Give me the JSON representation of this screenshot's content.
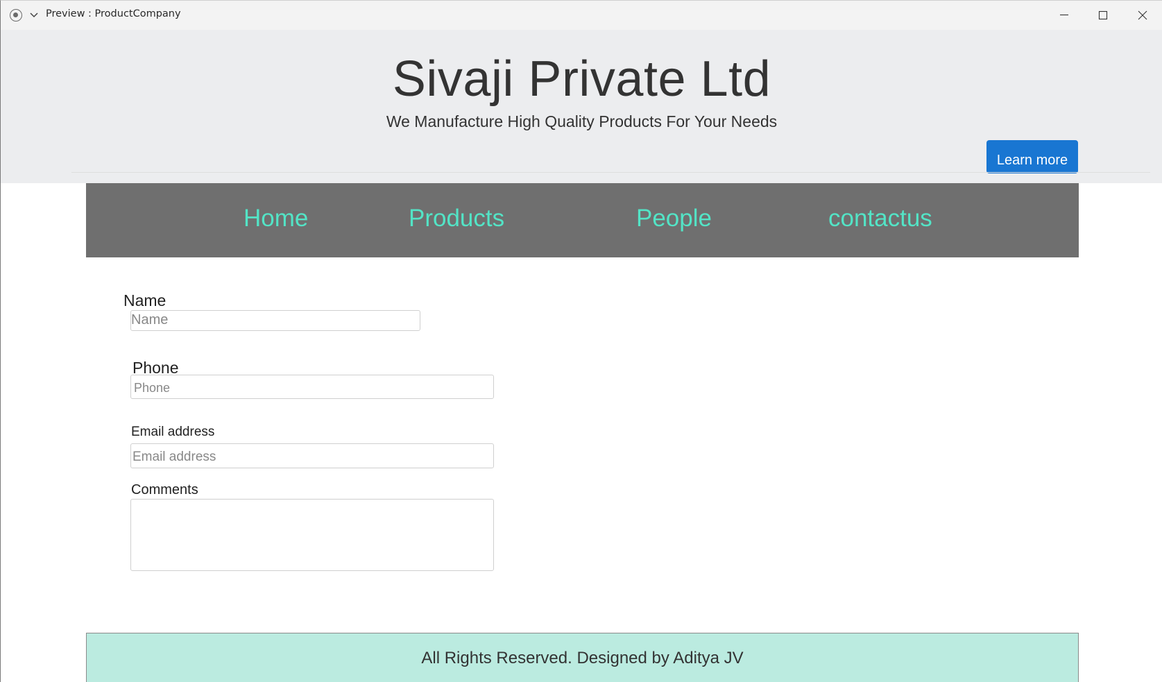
{
  "window": {
    "title": "Preview : ProductCompany"
  },
  "jumbotron": {
    "title": "Sivaji Private Ltd",
    "subtitle": "We Manufacture High Quality Products For Your Needs",
    "button_label": "Learn more"
  },
  "nav": {
    "items": [
      {
        "label": "Home"
      },
      {
        "label": "Products"
      },
      {
        "label": "People"
      },
      {
        "label": "contactus"
      }
    ]
  },
  "form": {
    "name": {
      "label": "Name",
      "placeholder": "Name"
    },
    "phone": {
      "label": "Phone",
      "placeholder": "Phone"
    },
    "email": {
      "label": "Email address",
      "placeholder": "Email address"
    },
    "comments": {
      "label": "Comments"
    }
  },
  "footer": {
    "text": "All Rights Reserved. Designed by Aditya JV"
  },
  "colors": {
    "jumbotron_bg": "#ecedef",
    "nav_bg": "#6f6f6f",
    "nav_link": "#53e4c6",
    "button_bg": "#1976d2",
    "footer_bg": "#bbebe0"
  },
  "icons": [
    "app-icon",
    "chevron-down-icon",
    "minimize-icon",
    "maximize-icon",
    "close-icon"
  ]
}
